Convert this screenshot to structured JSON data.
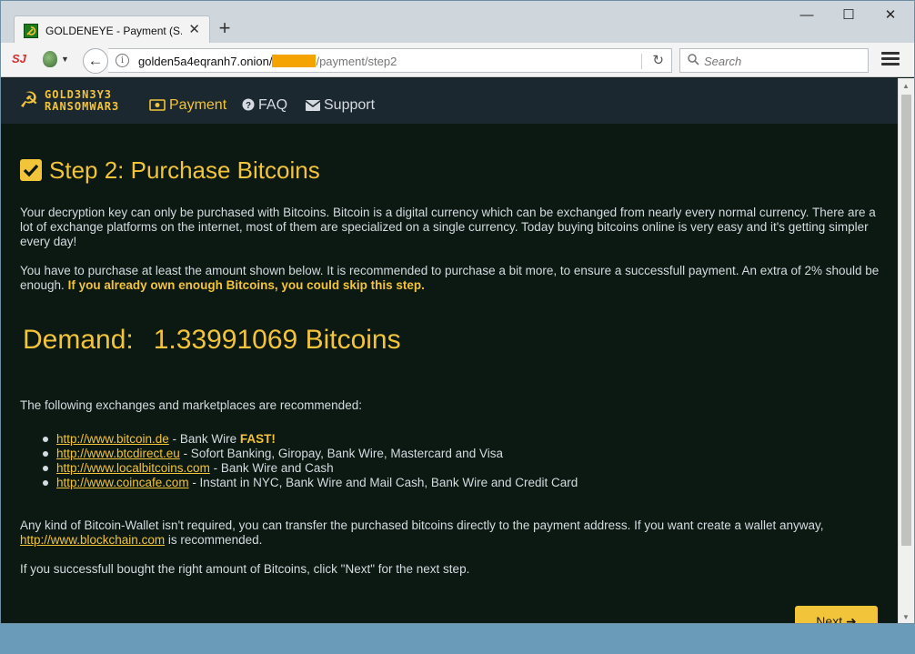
{
  "browser": {
    "tab_title": "GOLDENEYE - Payment (S...",
    "tab_close": "✕",
    "new_tab": "+",
    "url_host": "golden5a4eqranh7.onion/",
    "url_path": "/payment/step2",
    "search_placeholder": "Search",
    "ext1_label": "SJ"
  },
  "site": {
    "logo_line1": "GOLD3N3Y3",
    "logo_line2": "RANSOMWAR3",
    "nav": [
      {
        "label": "Payment"
      },
      {
        "label": "FAQ"
      },
      {
        "label": "Support"
      }
    ],
    "step_title": "Step 2: Purchase Bitcoins",
    "intro": "Your decryption key can only be purchased with Bitcoins. Bitcoin is a digital currency which can be exchanged from nearly every normal currency. There are a lot of exchange platforms on the internet, most of them are specialized on a single currency. Today buying bitcoins online is very easy and it's getting simpler every day!",
    "amount_text": "You have to purchase at least the amount shown below. It is recommended to purchase a bit more, to ensure a successfull payment. An extra of 2% should be enough.",
    "amount_highlight": "If you already own enough Bitcoins, you could skip this step.",
    "demand_label": "Demand:",
    "demand_value": "1.33991069 Bitcoins",
    "exchanges_intro": "The following exchanges and marketplaces are recommended:",
    "exchanges": [
      {
        "url": "http://www.bitcoin.de",
        "desc": " - Bank Wire ",
        "extra": "FAST!"
      },
      {
        "url": "http://www.btcdirect.eu",
        "desc": " - Sofort Banking, Giropay, Bank Wire, Mastercard and Visa",
        "extra": ""
      },
      {
        "url": "http://www.localbitcoins.com",
        "desc": " - Bank Wire and Cash",
        "extra": ""
      },
      {
        "url": "http://www.coincafe.com",
        "desc": " - Instant in NYC, Bank Wire and Mail Cash, Bank Wire and Credit Card",
        "extra": ""
      }
    ],
    "wallet_text": "Any kind of Bitcoin-Wallet isn't required, you can transfer the purchased bitcoins directly to the payment address. If you want create a wallet anyway,",
    "wallet_link": "http://www.blockchain.com",
    "wallet_suffix": " is recommended.",
    "next_info": "If you successfull bought the right amount of Bitcoins, click \"Next\" for the next step.",
    "next_label": "Next ➜"
  },
  "colors": {
    "accent": "#f2c43a",
    "page_bg": "#0c1812",
    "nav_bg": "#1c2830"
  }
}
